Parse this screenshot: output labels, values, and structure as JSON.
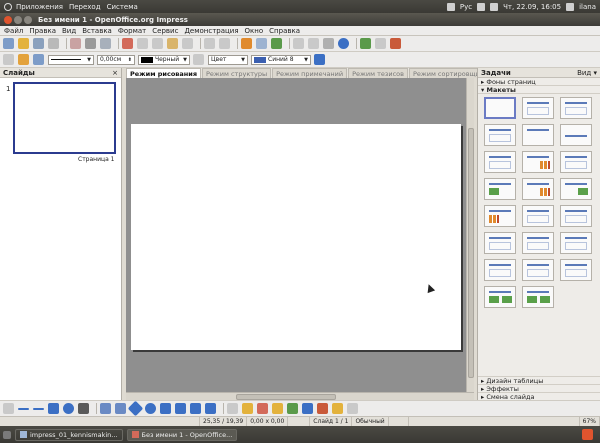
{
  "top_panel": {
    "menus": [
      "Приложения",
      "Переход",
      "Система"
    ],
    "keyboard_layout": "Рус",
    "clock": "Чт, 22.09, 16:05",
    "user": "ilana"
  },
  "window": {
    "title": "Без имени 1 - OpenOffice.org Impress"
  },
  "menubar": [
    "Файл",
    "Правка",
    "Вид",
    "Вставка",
    "Формат",
    "Сервис",
    "Демонстрация",
    "Окно",
    "Справка"
  ],
  "line_toolbar": {
    "line_width": "0,00см",
    "line_color": "Черный",
    "area_style": "Цвет",
    "area_color": "Синий 8"
  },
  "slides_pane": {
    "title": "Слайды",
    "close_glyph": "×",
    "slide_number": "1",
    "slide_caption": "Страница 1"
  },
  "view_tabs": [
    "Режим рисования",
    "Режим структуры",
    "Режим примечаний",
    "Режим тезисов",
    "Режим сортировщика слайдов"
  ],
  "tasks_pane": {
    "title": "Задачи",
    "view_label": "Вид ▾",
    "master_pages": "Фоны страниц",
    "layouts": "Макеты",
    "table_design": "Дизайн таблицы",
    "effects": "Эффекты",
    "transition": "Смена слайда"
  },
  "statusbar": {
    "position": "25,35 / 19,39",
    "size": "0,00 x 0,00",
    "slide": "Слайд 1 / 1",
    "master": "Обычный",
    "zoom": "67%"
  },
  "taskbar": {
    "items": [
      "impress_01_kennismakin...",
      "Без имени 1 - OpenOffice..."
    ]
  },
  "colors": {
    "panel": "#3c3b37",
    "close_button": "#e0542e",
    "selection_border": "#2b3b8f",
    "area_color_swatch": "#3b5fb0"
  }
}
